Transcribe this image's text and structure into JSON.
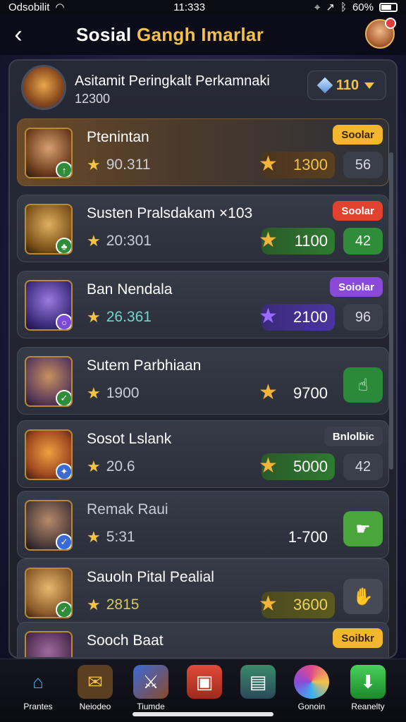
{
  "status_bar": {
    "carrier": "Odsobilit",
    "time": "11:333",
    "battery": "60%"
  },
  "header": {
    "title_part1": "Sosial",
    "title_part2": "Gangh Imarlar"
  },
  "panel": {
    "title": "Asitamit Peringkalt Perkamnaki",
    "subtitle": "12300",
    "filter_value": "110"
  },
  "rows": [
    {
      "name": "Ptenintan",
      "score": "90.311",
      "value": "1300",
      "rank": "56",
      "badge": "Soolar"
    },
    {
      "name": "Susten Pralsdakam ×103",
      "score": "20:301",
      "value": "1100",
      "rank": "42",
      "badge": "Soolar"
    },
    {
      "name": "Ban Nendala",
      "score": "26.361",
      "value": "2100",
      "rank": "96",
      "badge": "Soiolar"
    },
    {
      "name": "Sutem Parbhiaan",
      "score": "1900",
      "value": "9700",
      "rank": ""
    },
    {
      "name": "Sosot Lslank",
      "score": "20.6",
      "value": "5000",
      "rank": "42",
      "badge": "Bnlolbic"
    },
    {
      "name": "Remak Raui",
      "score": "5:31",
      "value": "1-700",
      "rank": ""
    },
    {
      "name": "Sauoln Pital Pealial",
      "score": "2815",
      "value": "3600",
      "rank": ""
    },
    {
      "name": "Sooch Baat",
      "badge": "Soibkr"
    }
  ],
  "nav": {
    "items": [
      {
        "label": "Prantes"
      },
      {
        "label": "Neiodeo"
      },
      {
        "label": "Tiumde"
      },
      {
        "label": ""
      },
      {
        "label": ""
      },
      {
        "label": "Gonoin"
      },
      {
        "label": "Reanelty"
      }
    ]
  }
}
